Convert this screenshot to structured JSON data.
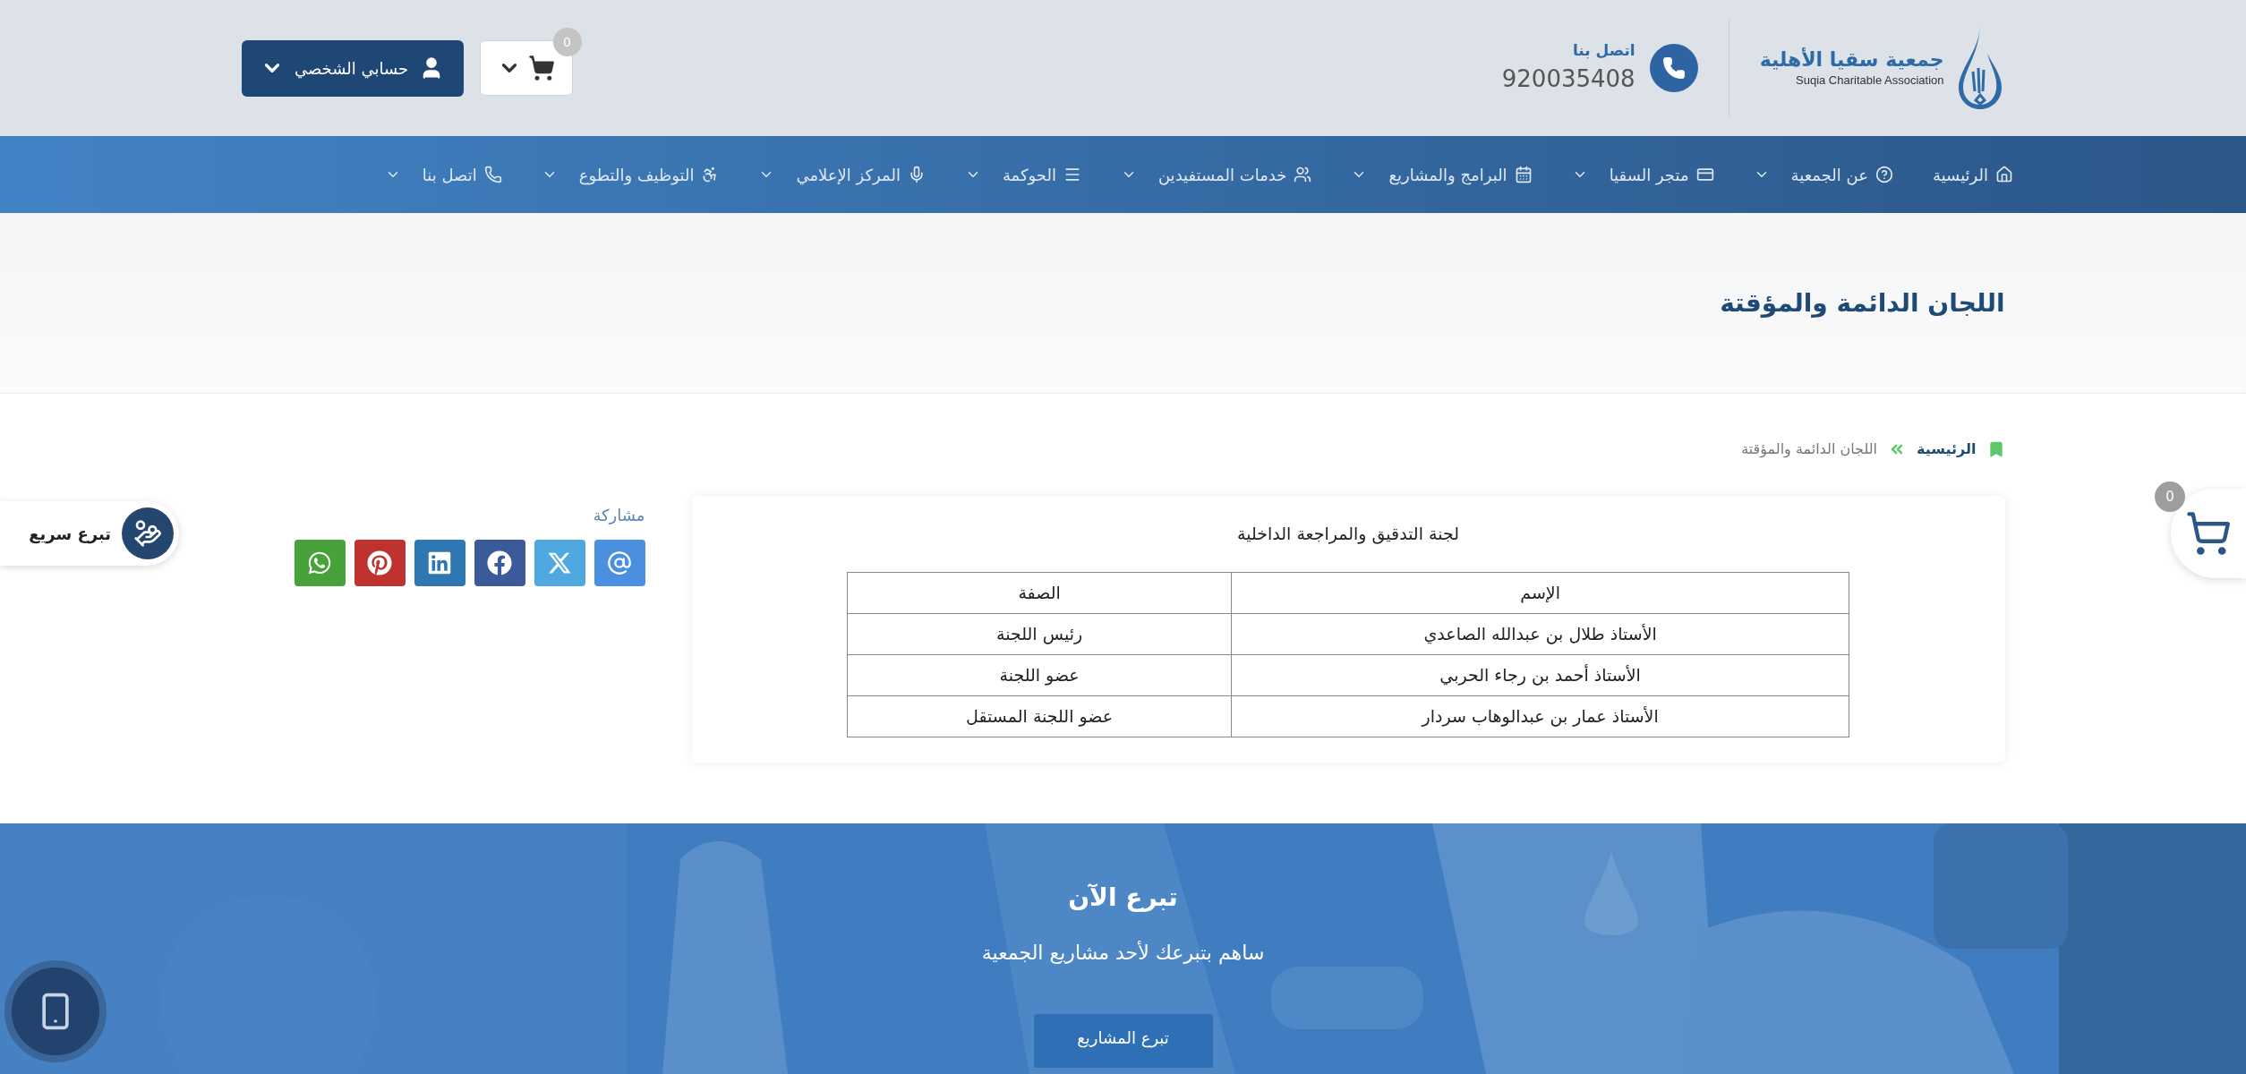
{
  "header": {
    "logo": {
      "arabic": "جمعية سقيا الأهلية",
      "english": "Suqia Charitable Association"
    },
    "contact": {
      "label": "اتصل بنا",
      "phone": "920035408"
    },
    "cart": {
      "count": "0"
    },
    "account": {
      "label": "حسابي الشخصي"
    }
  },
  "nav": [
    {
      "label": "الرئيسية",
      "kind": "home",
      "dropdown": false
    },
    {
      "label": "عن الجمعية",
      "kind": "about",
      "dropdown": true
    },
    {
      "label": "متجر السقيا",
      "kind": "store",
      "dropdown": true
    },
    {
      "label": "البرامج والمشاريع",
      "kind": "programs",
      "dropdown": true
    },
    {
      "label": "خدمات المستفيدين",
      "kind": "beneficiaries",
      "dropdown": true
    },
    {
      "label": "الحوكمة",
      "kind": "governance",
      "dropdown": true
    },
    {
      "label": "المركز الإعلامي",
      "kind": "media",
      "dropdown": true
    },
    {
      "label": "التوظيف والتطوع",
      "kind": "jobs",
      "dropdown": true
    },
    {
      "label": "اتصل بنا",
      "kind": "contact",
      "dropdown": true
    }
  ],
  "page_title": "اللجان الدائمة والمؤقتة",
  "breadcrumb": [
    {
      "label": "الرئيسية",
      "kind": "link"
    },
    {
      "label": "اللجان الدائمة والمؤقتة",
      "kind": "current"
    }
  ],
  "committee": {
    "title": "لجنة التدقيق والمراجعة الداخلية",
    "columns": [
      "الإسم",
      "الصفة"
    ],
    "rows": [
      [
        "الأستاذ طلال بن عبدالله الصاعدي",
        "رئيس اللجنة"
      ],
      [
        "الأستاذ أحمد بن رجاء الحربي",
        "عضو اللجنة"
      ],
      [
        "الأستاذ عمار بن عبدالوهاب سردار",
        "عضو اللجنة المستقل"
      ]
    ]
  },
  "share": {
    "label": "مشاركة",
    "buttons": [
      {
        "kind": "email",
        "color": "#4a8fe0"
      },
      {
        "kind": "x",
        "color": "#4fa8e0"
      },
      {
        "kind": "facebook",
        "color": "#3b5a9a"
      },
      {
        "kind": "linkedin",
        "color": "#2f77b2"
      },
      {
        "kind": "pinterest",
        "color": "#c0322f"
      },
      {
        "kind": "whatsapp",
        "color": "#48a23a"
      }
    ]
  },
  "quick_donate": {
    "label": "تبرع سريع"
  },
  "floating_cart": {
    "count": "0"
  },
  "banner": {
    "title": "تبرع الآن",
    "subtitle": "ساهم بتبرعك لأحد مشاريع الجمعية",
    "button": "تبرع المشاريع"
  }
}
